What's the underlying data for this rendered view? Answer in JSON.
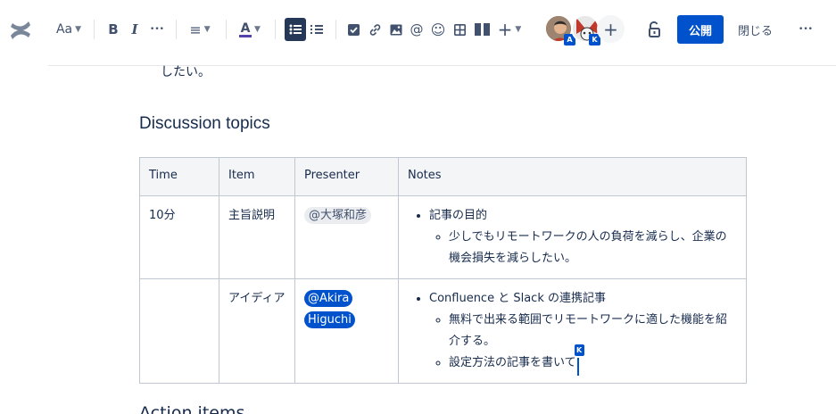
{
  "toolbar": {
    "text_style": "Aa",
    "bold": "B",
    "italic": "I",
    "more_format": "•••",
    "align": "≡",
    "text_color_letter": "A",
    "insert_plus": "+",
    "publish_label": "公開",
    "close_label": "閉じる",
    "more_label": "•••",
    "collaborators": [
      {
        "badge": "A",
        "color": "#0052cc"
      },
      {
        "badge": "K",
        "color": "#0052cc"
      }
    ],
    "add_collaborator": "+",
    "text_color_bar": "#5243aa"
  },
  "content": {
    "leftover_text": "したい。",
    "heading": "Discussion topics",
    "table": {
      "headers": [
        "Time",
        "Item",
        "Presenter",
        "Notes"
      ],
      "rows": [
        {
          "time": "10分",
          "item": "主旨説明",
          "presenter": "@大塚和彦",
          "note_main": "記事の目的",
          "note_subs": [
            "少しでもリモートワークの人の負荷を減らし、企業の機会損失を減らしたい。"
          ]
        },
        {
          "time": "",
          "item": "アイディア",
          "presenter": "@Akira Higuchi",
          "note_main": "Confluence と Slack の連携記事",
          "note_subs": [
            "無料で出来る範囲でリモートワークに適した機能を紹介する。",
            "設定方法の記事を書いて"
          ]
        }
      ]
    },
    "cursor_badge": "K",
    "next_heading_partial": "Action items"
  }
}
